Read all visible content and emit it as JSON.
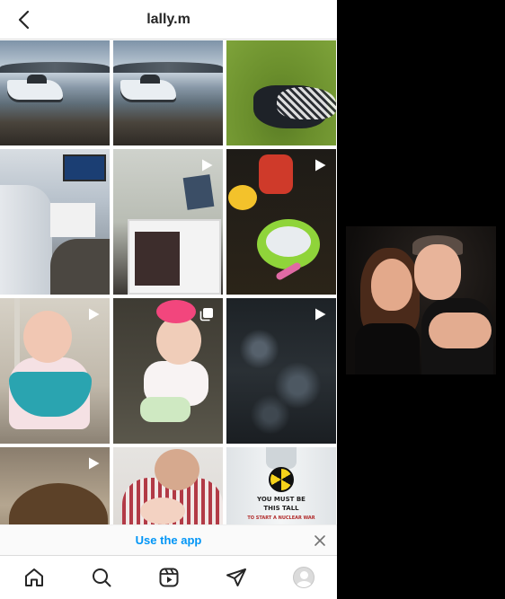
{
  "header": {
    "title": "lally.m"
  },
  "grid": [
    {
      "kind": "photo",
      "badge": "none",
      "style": "boat"
    },
    {
      "kind": "photo",
      "badge": "none",
      "style": "boat"
    },
    {
      "kind": "photo",
      "badge": "none",
      "style": "grass"
    },
    {
      "kind": "photo",
      "badge": "none",
      "style": "plane"
    },
    {
      "kind": "video",
      "badge": "play-icon",
      "style": "room"
    },
    {
      "kind": "video",
      "badge": "play-icon",
      "style": "kids"
    },
    {
      "kind": "video",
      "badge": "play-icon",
      "style": "baby1"
    },
    {
      "kind": "carousel",
      "badge": "carousel-icon",
      "style": "baby2"
    },
    {
      "kind": "video",
      "badge": "play-icon",
      "style": "bokeh"
    },
    {
      "kind": "video",
      "badge": "play-icon",
      "style": "hair"
    },
    {
      "kind": "photo",
      "badge": "none",
      "style": "dad"
    },
    {
      "kind": "photo",
      "badge": "none",
      "style": "bottle"
    }
  ],
  "bottle_text": {
    "line1": "YOU MUST BE",
    "line2": "THIS TALL",
    "line3": "TO START A NUCLEAR WAR"
  },
  "use_app": {
    "label": "Use the app"
  },
  "nav": [
    "home-icon",
    "search-icon",
    "reels-icon",
    "direct-icon",
    "profile-avatar"
  ],
  "colors": {
    "link": "#0095f6",
    "text": "#262626",
    "border": "#dbdbdb"
  }
}
